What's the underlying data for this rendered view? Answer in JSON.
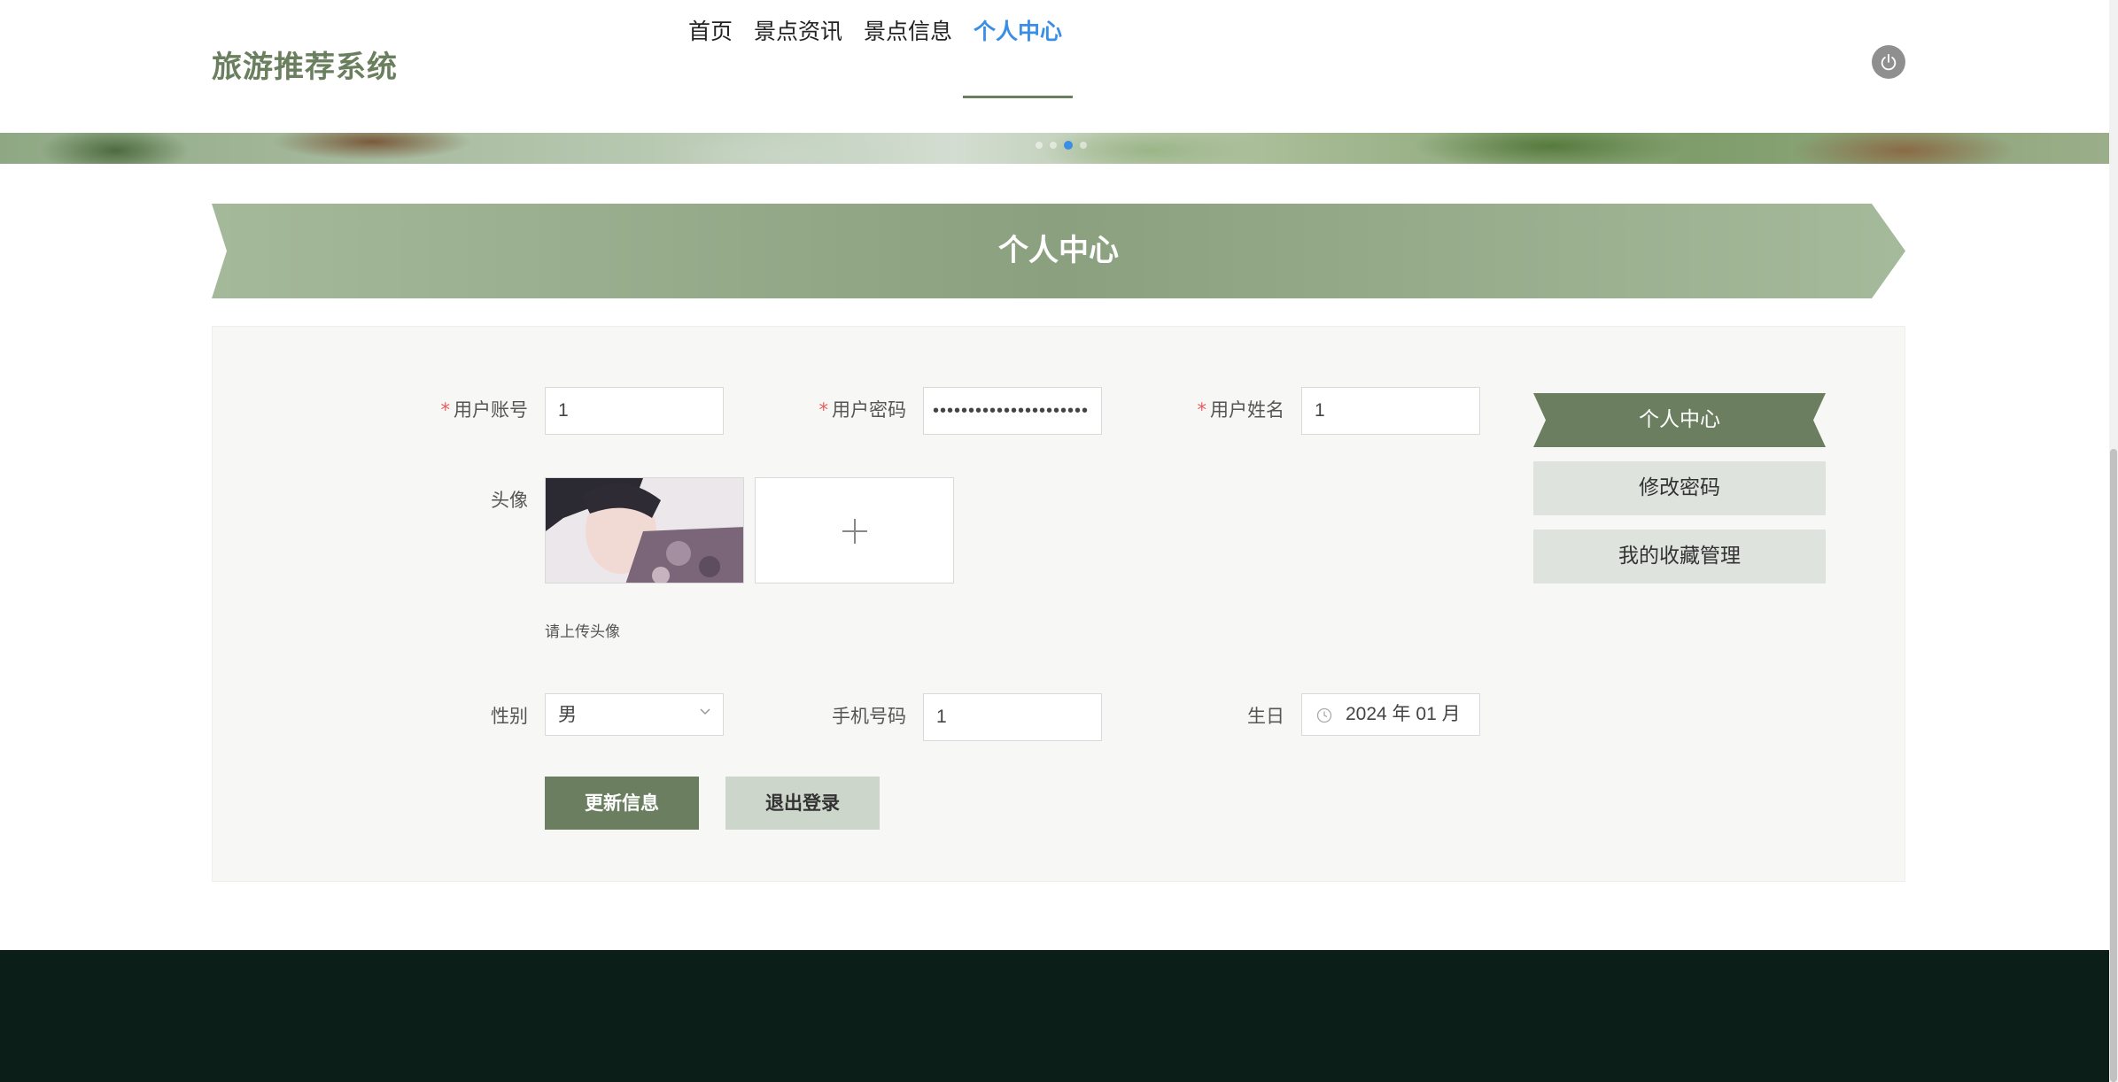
{
  "header": {
    "logo": "旅游推荐系统",
    "nav": [
      "首页",
      "景点资讯",
      "景点信息",
      "个人中心"
    ],
    "active_index": 3
  },
  "banner": {
    "dot_count": 4,
    "active_dot": 2
  },
  "section_title": "个人中心",
  "form": {
    "account": {
      "label": "用户账号",
      "value": "1",
      "required": true
    },
    "password": {
      "label": "用户密码",
      "value": "••••••••••••••••••••••",
      "required": true
    },
    "name": {
      "label": "用户姓名",
      "value": "1",
      "required": true
    },
    "avatar": {
      "label": "头像",
      "hint": "请上传头像"
    },
    "gender": {
      "label": "性别",
      "value": "男"
    },
    "phone": {
      "label": "手机号码",
      "value": "1"
    },
    "birthday": {
      "label": "生日",
      "value": "2024 年 01 月"
    },
    "update_button": "更新信息",
    "logout_button": "退出登录"
  },
  "side_menu": [
    "个人中心",
    "修改密码",
    "我的收藏管理"
  ],
  "colors": {
    "brand_green": "#6b7f60",
    "nav_active": "#3a8ee6",
    "required": "#e35d5d",
    "footer": "#0b1f18"
  }
}
